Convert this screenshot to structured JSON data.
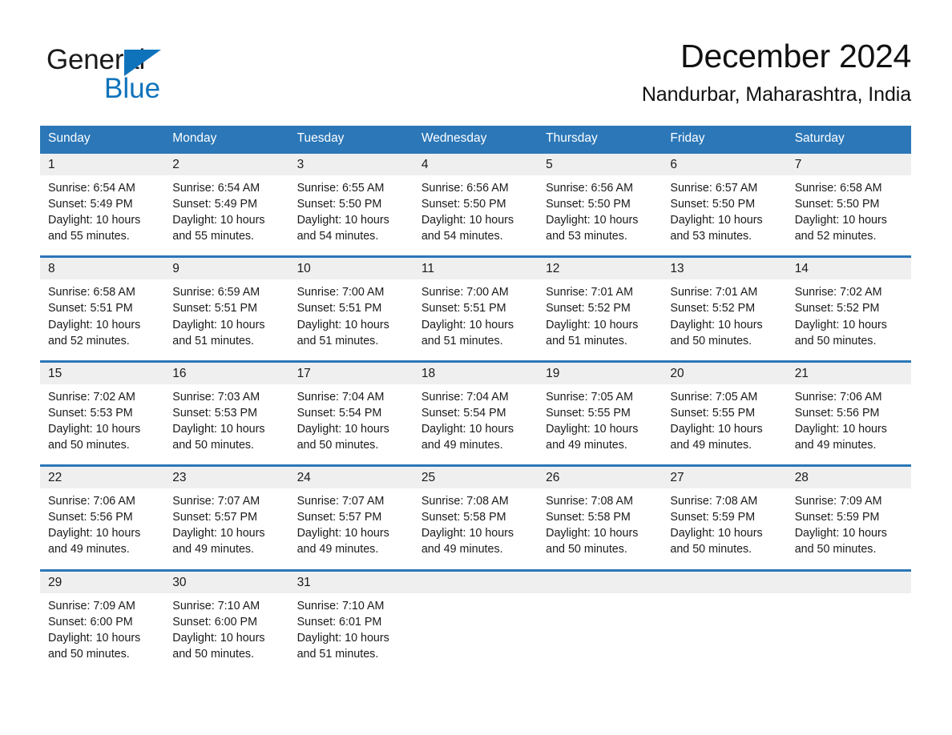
{
  "brand": {
    "name_part1": "General",
    "name_part2": "Blue",
    "triangle_icon": "triangle-icon",
    "accent_color": "#0f73bb"
  },
  "header": {
    "title": "December 2024",
    "subtitle": "Nandurbar, Maharashtra, India"
  },
  "colors": {
    "header_blue": "#2b77b8",
    "day_band_gray": "#efefef",
    "text": "#1a1a1a"
  },
  "weekday_headers": [
    "Sunday",
    "Monday",
    "Tuesday",
    "Wednesday",
    "Thursday",
    "Friday",
    "Saturday"
  ],
  "weeks": [
    [
      {
        "day": "1",
        "sunrise": "Sunrise: 6:54 AM",
        "sunset": "Sunset: 5:49 PM",
        "daylight1": "Daylight: 10 hours",
        "daylight2": "and 55 minutes."
      },
      {
        "day": "2",
        "sunrise": "Sunrise: 6:54 AM",
        "sunset": "Sunset: 5:49 PM",
        "daylight1": "Daylight: 10 hours",
        "daylight2": "and 55 minutes."
      },
      {
        "day": "3",
        "sunrise": "Sunrise: 6:55 AM",
        "sunset": "Sunset: 5:50 PM",
        "daylight1": "Daylight: 10 hours",
        "daylight2": "and 54 minutes."
      },
      {
        "day": "4",
        "sunrise": "Sunrise: 6:56 AM",
        "sunset": "Sunset: 5:50 PM",
        "daylight1": "Daylight: 10 hours",
        "daylight2": "and 54 minutes."
      },
      {
        "day": "5",
        "sunrise": "Sunrise: 6:56 AM",
        "sunset": "Sunset: 5:50 PM",
        "daylight1": "Daylight: 10 hours",
        "daylight2": "and 53 minutes."
      },
      {
        "day": "6",
        "sunrise": "Sunrise: 6:57 AM",
        "sunset": "Sunset: 5:50 PM",
        "daylight1": "Daylight: 10 hours",
        "daylight2": "and 53 minutes."
      },
      {
        "day": "7",
        "sunrise": "Sunrise: 6:58 AM",
        "sunset": "Sunset: 5:50 PM",
        "daylight1": "Daylight: 10 hours",
        "daylight2": "and 52 minutes."
      }
    ],
    [
      {
        "day": "8",
        "sunrise": "Sunrise: 6:58 AM",
        "sunset": "Sunset: 5:51 PM",
        "daylight1": "Daylight: 10 hours",
        "daylight2": "and 52 minutes."
      },
      {
        "day": "9",
        "sunrise": "Sunrise: 6:59 AM",
        "sunset": "Sunset: 5:51 PM",
        "daylight1": "Daylight: 10 hours",
        "daylight2": "and 51 minutes."
      },
      {
        "day": "10",
        "sunrise": "Sunrise: 7:00 AM",
        "sunset": "Sunset: 5:51 PM",
        "daylight1": "Daylight: 10 hours",
        "daylight2": "and 51 minutes."
      },
      {
        "day": "11",
        "sunrise": "Sunrise: 7:00 AM",
        "sunset": "Sunset: 5:51 PM",
        "daylight1": "Daylight: 10 hours",
        "daylight2": "and 51 minutes."
      },
      {
        "day": "12",
        "sunrise": "Sunrise: 7:01 AM",
        "sunset": "Sunset: 5:52 PM",
        "daylight1": "Daylight: 10 hours",
        "daylight2": "and 51 minutes."
      },
      {
        "day": "13",
        "sunrise": "Sunrise: 7:01 AM",
        "sunset": "Sunset: 5:52 PM",
        "daylight1": "Daylight: 10 hours",
        "daylight2": "and 50 minutes."
      },
      {
        "day": "14",
        "sunrise": "Sunrise: 7:02 AM",
        "sunset": "Sunset: 5:52 PM",
        "daylight1": "Daylight: 10 hours",
        "daylight2": "and 50 minutes."
      }
    ],
    [
      {
        "day": "15",
        "sunrise": "Sunrise: 7:02 AM",
        "sunset": "Sunset: 5:53 PM",
        "daylight1": "Daylight: 10 hours",
        "daylight2": "and 50 minutes."
      },
      {
        "day": "16",
        "sunrise": "Sunrise: 7:03 AM",
        "sunset": "Sunset: 5:53 PM",
        "daylight1": "Daylight: 10 hours",
        "daylight2": "and 50 minutes."
      },
      {
        "day": "17",
        "sunrise": "Sunrise: 7:04 AM",
        "sunset": "Sunset: 5:54 PM",
        "daylight1": "Daylight: 10 hours",
        "daylight2": "and 50 minutes."
      },
      {
        "day": "18",
        "sunrise": "Sunrise: 7:04 AM",
        "sunset": "Sunset: 5:54 PM",
        "daylight1": "Daylight: 10 hours",
        "daylight2": "and 49 minutes."
      },
      {
        "day": "19",
        "sunrise": "Sunrise: 7:05 AM",
        "sunset": "Sunset: 5:55 PM",
        "daylight1": "Daylight: 10 hours",
        "daylight2": "and 49 minutes."
      },
      {
        "day": "20",
        "sunrise": "Sunrise: 7:05 AM",
        "sunset": "Sunset: 5:55 PM",
        "daylight1": "Daylight: 10 hours",
        "daylight2": "and 49 minutes."
      },
      {
        "day": "21",
        "sunrise": "Sunrise: 7:06 AM",
        "sunset": "Sunset: 5:56 PM",
        "daylight1": "Daylight: 10 hours",
        "daylight2": "and 49 minutes."
      }
    ],
    [
      {
        "day": "22",
        "sunrise": "Sunrise: 7:06 AM",
        "sunset": "Sunset: 5:56 PM",
        "daylight1": "Daylight: 10 hours",
        "daylight2": "and 49 minutes."
      },
      {
        "day": "23",
        "sunrise": "Sunrise: 7:07 AM",
        "sunset": "Sunset: 5:57 PM",
        "daylight1": "Daylight: 10 hours",
        "daylight2": "and 49 minutes."
      },
      {
        "day": "24",
        "sunrise": "Sunrise: 7:07 AM",
        "sunset": "Sunset: 5:57 PM",
        "daylight1": "Daylight: 10 hours",
        "daylight2": "and 49 minutes."
      },
      {
        "day": "25",
        "sunrise": "Sunrise: 7:08 AM",
        "sunset": "Sunset: 5:58 PM",
        "daylight1": "Daylight: 10 hours",
        "daylight2": "and 49 minutes."
      },
      {
        "day": "26",
        "sunrise": "Sunrise: 7:08 AM",
        "sunset": "Sunset: 5:58 PM",
        "daylight1": "Daylight: 10 hours",
        "daylight2": "and 50 minutes."
      },
      {
        "day": "27",
        "sunrise": "Sunrise: 7:08 AM",
        "sunset": "Sunset: 5:59 PM",
        "daylight1": "Daylight: 10 hours",
        "daylight2": "and 50 minutes."
      },
      {
        "day": "28",
        "sunrise": "Sunrise: 7:09 AM",
        "sunset": "Sunset: 5:59 PM",
        "daylight1": "Daylight: 10 hours",
        "daylight2": "and 50 minutes."
      }
    ],
    [
      {
        "day": "29",
        "sunrise": "Sunrise: 7:09 AM",
        "sunset": "Sunset: 6:00 PM",
        "daylight1": "Daylight: 10 hours",
        "daylight2": "and 50 minutes."
      },
      {
        "day": "30",
        "sunrise": "Sunrise: 7:10 AM",
        "sunset": "Sunset: 6:00 PM",
        "daylight1": "Daylight: 10 hours",
        "daylight2": "and 50 minutes."
      },
      {
        "day": "31",
        "sunrise": "Sunrise: 7:10 AM",
        "sunset": "Sunset: 6:01 PM",
        "daylight1": "Daylight: 10 hours",
        "daylight2": "and 51 minutes."
      },
      {
        "day": "",
        "sunrise": "",
        "sunset": "",
        "daylight1": "",
        "daylight2": ""
      },
      {
        "day": "",
        "sunrise": "",
        "sunset": "",
        "daylight1": "",
        "daylight2": ""
      },
      {
        "day": "",
        "sunrise": "",
        "sunset": "",
        "daylight1": "",
        "daylight2": ""
      },
      {
        "day": "",
        "sunrise": "",
        "sunset": "",
        "daylight1": "",
        "daylight2": ""
      }
    ]
  ]
}
